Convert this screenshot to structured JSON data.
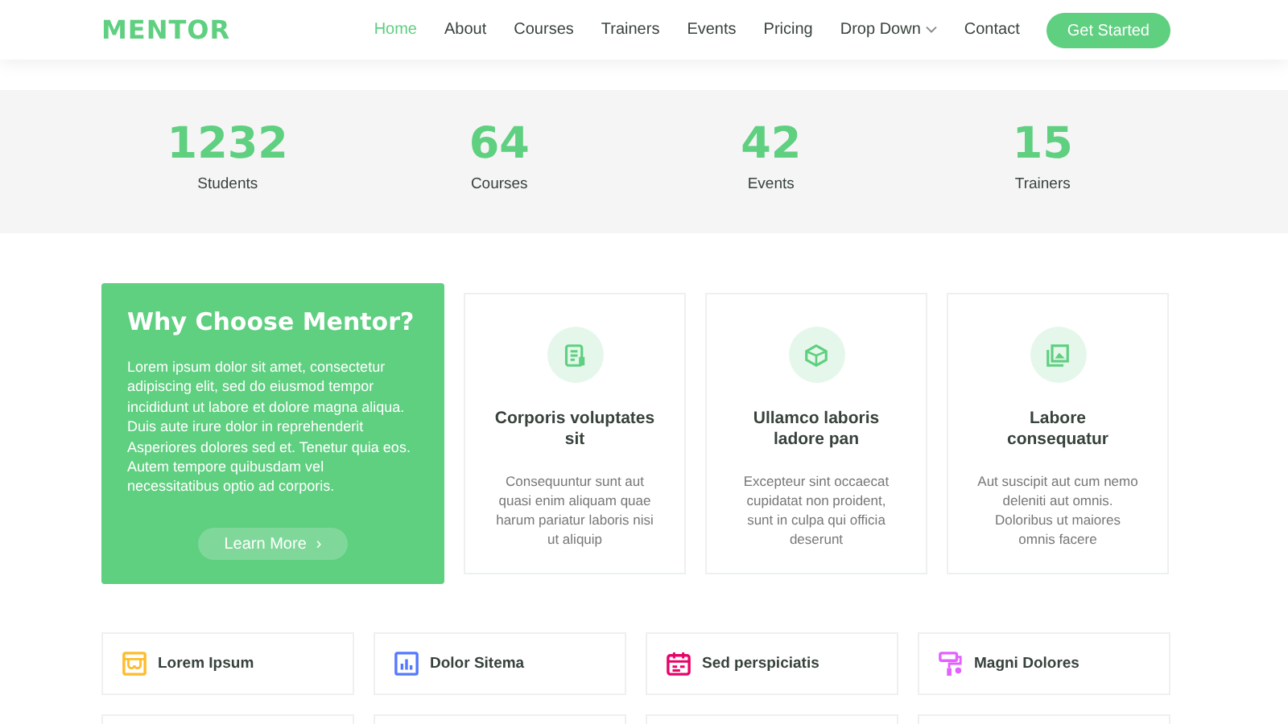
{
  "header": {
    "logo": "MENTOR",
    "nav": [
      {
        "label": "Home",
        "selected": true,
        "dropdown": false
      },
      {
        "label": "About",
        "selected": false,
        "dropdown": false
      },
      {
        "label": "Courses",
        "selected": false,
        "dropdown": false
      },
      {
        "label": "Trainers",
        "selected": false,
        "dropdown": false
      },
      {
        "label": "Events",
        "selected": false,
        "dropdown": false
      },
      {
        "label": "Pricing",
        "selected": false,
        "dropdown": false
      },
      {
        "label": "Drop Down",
        "selected": false,
        "dropdown": true
      },
      {
        "label": "Contact",
        "selected": false,
        "dropdown": false
      }
    ],
    "cta": "Get Started"
  },
  "stats": [
    {
      "value": "1232",
      "label": "Students"
    },
    {
      "value": "64",
      "label": "Courses"
    },
    {
      "value": "42",
      "label": "Events"
    },
    {
      "value": "15",
      "label": "Trainers"
    }
  ],
  "why": {
    "title": "Why Choose Mentor?",
    "text": "Lorem ipsum dolor sit amet, consectetur adipiscing elit, sed do eiusmod tempor incididunt ut labore et dolore magna aliqua. Duis aute irure dolor in reprehenderit Asperiores dolores sed et. Tenetur quia eos. Autem tempore quibusdam vel necessitatibus optio ad corporis.",
    "button": "Learn More",
    "button_icon": "›"
  },
  "cards": [
    {
      "kind": "receipt",
      "title": "Corporis voluptates sit",
      "text": "Consequuntur sunt aut quasi enim aliquam quae harum pariatur laboris nisi ut aliquip"
    },
    {
      "kind": "cube",
      "title": "Ullamco laboris ladore pan",
      "text": "Excepteur sint occaecat cupidatat non proident, sunt in culpa qui officia deserunt"
    },
    {
      "kind": "images",
      "title": "Labore consequatur",
      "text": "Aut suscipit aut cum nemo deleniti aut omnis. Doloribus ut maiores omnis facere"
    }
  ],
  "features": [
    {
      "kind": "store",
      "label": "Lorem Ipsum",
      "color": "#ffbb2c"
    },
    {
      "kind": "chart",
      "label": "Dolor Sitema",
      "color": "#5578ff"
    },
    {
      "kind": "calendar",
      "label": "Sed perspiciatis",
      "color": "#e80368"
    },
    {
      "kind": "paint",
      "label": "Magni Dolores",
      "color": "#e361ff"
    }
  ]
}
